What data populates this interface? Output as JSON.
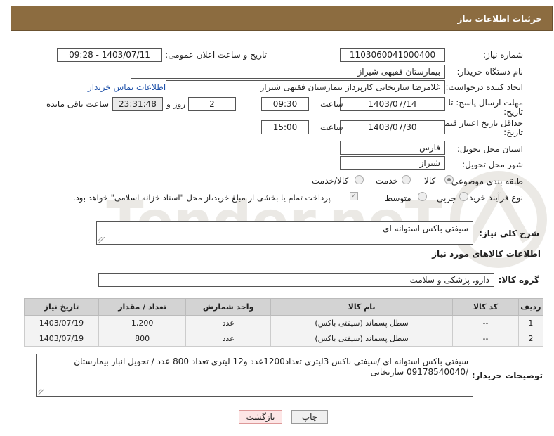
{
  "header": {
    "title": "جزئیات اطلاعات نیاز"
  },
  "form": {
    "need_number_label": "شماره نیاز:",
    "need_number": "1103060041000400",
    "announce_label": "تاریخ و ساعت اعلان عمومی:",
    "announce_value": "1403/07/11 - 09:28",
    "buyer_org_label": "نام دستگاه خریدار:",
    "buyer_org": "بیمارستان فقیهی شیراز",
    "requester_label": "ایجاد کننده درخواست:",
    "requester": "غلامرضا ساریخانی کارپرداز بیمارستان فقیهی شیراز",
    "buyer_contact_link": "اطلاعات تماس خریدار",
    "deadline_label_1": "مهلت ارسال پاسخ: تا",
    "deadline_label_2": "تاریخ:",
    "deadline_date": "1403/07/14",
    "hour_label": "ساعت",
    "deadline_time": "09:30",
    "days_value": "2",
    "day_and_label": "روز و",
    "remaining_time": "23:31:48",
    "remaining_label": "ساعت باقی مانده",
    "validity_label_1": "حداقل تاریخ اعتبار قیمت: تا",
    "validity_label_2": "تاریخ:",
    "validity_date": "1403/07/30",
    "validity_time": "15:00",
    "province_label": "استان محل تحویل:",
    "province": "فارس",
    "city_label": "شهر محل تحویل:",
    "city": "شیراز",
    "category_label": "طبقه بندی موضوعی:",
    "category_options": [
      "کالا",
      "خدمت",
      "کالا/خدمت"
    ],
    "category_selected": "کالا",
    "process_label": "نوع فرآیند خرید :",
    "process_options": [
      "جزیی",
      "متوسط"
    ],
    "payment_note": "پرداخت تمام یا بخشی از مبلغ خرید،از محل \"اسناد خزانه اسلامی\" خواهد بود.",
    "summary_label": "شرح کلی نیاز:",
    "summary": "سیفتی باکس استوانه ای"
  },
  "items_section": {
    "title": "اطلاعات کالاهای مورد نیاز",
    "group_label": "گروه کالا:",
    "group_value": "دارو، پزشکی و سلامت",
    "columns": [
      "ردیف",
      "کد کالا",
      "نام کالا",
      "واحد شمارش",
      "تعداد / مقدار",
      "تاریخ نیاز"
    ],
    "rows": [
      [
        "1",
        "--",
        "سطل پسماند (سیفتی باکس)",
        "عدد",
        "1,200",
        "1403/07/19"
      ],
      [
        "2",
        "--",
        "سطل پسماند (سیفتی باکس)",
        "عدد",
        "800",
        "1403/07/19"
      ]
    ]
  },
  "buyer_notes": {
    "label": "توضیحات خریدار:",
    "text": "سیفتی باکس استوانه ای /سیفتی باکس 3لیتری تعداد1200عدد و12 لیتری تعداد 800 عدد / تحویل انبار بیمارستان /09178540040 ساریخانی"
  },
  "buttons": {
    "print": "چاپ",
    "back": "بازگشت"
  },
  "watermark": {
    "text": "AriaTender.neT"
  },
  "colors": {
    "header_bg": "#8c6c40",
    "link": "#1c4fa8"
  }
}
